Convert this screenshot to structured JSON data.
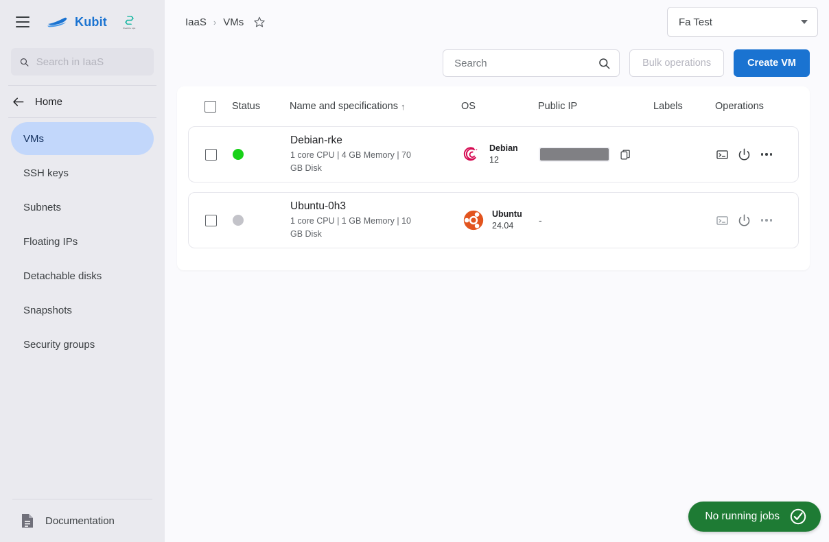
{
  "sidebar": {
    "menu_icon": "hamburger-icon",
    "brand": {
      "name": "Kubit",
      "logo": "kubit-boat-logo"
    },
    "partner": {
      "mark": "S",
      "subtitle": "Flexible ops"
    },
    "search": {
      "value": "",
      "placeholder": "Search in IaaS",
      "icon": "search-icon"
    },
    "home": {
      "label": "Home",
      "icon": "arrow-left-icon"
    },
    "items": [
      {
        "label": "VMs",
        "active": true
      },
      {
        "label": "SSH keys",
        "active": false
      },
      {
        "label": "Subnets",
        "active": false
      },
      {
        "label": "Floating IPs",
        "active": false
      },
      {
        "label": "Detachable disks",
        "active": false
      },
      {
        "label": "Snapshots",
        "active": false
      },
      {
        "label": "Security groups",
        "active": false
      }
    ],
    "documentation": {
      "label": "Documentation",
      "icon": "document-icon"
    }
  },
  "header": {
    "breadcrumbs": [
      {
        "label": "IaaS"
      },
      {
        "label": "VMs"
      }
    ],
    "separator": "›",
    "favorite_icon": "star-outline-icon",
    "project": {
      "selected": "Fa Test",
      "icon": "chevron-down-icon"
    }
  },
  "toolbar": {
    "search": {
      "value": "",
      "placeholder": "Search",
      "icon": "search-icon"
    },
    "bulk_operations_label": "Bulk operations",
    "bulk_operations_disabled": true,
    "create_label": "Create VM"
  },
  "table": {
    "select_all_checked": false,
    "columns": [
      {
        "key": "checkbox",
        "label": ""
      },
      {
        "key": "status",
        "label": "Status"
      },
      {
        "key": "name",
        "label": "Name and specifications",
        "sort": "↑"
      },
      {
        "key": "os",
        "label": "OS"
      },
      {
        "key": "public_ip",
        "label": "Public IP"
      },
      {
        "key": "labels",
        "label": "Labels"
      },
      {
        "key": "operations",
        "label": "Operations"
      }
    ],
    "rows": [
      {
        "checked": false,
        "status": "running",
        "name": "Debian-rke",
        "specs": "1 core CPU | 4 GB Memory | 70 GB Disk",
        "os_name": "Debian",
        "os_version": "12",
        "os_icon": "debian-logo",
        "public_ip": "",
        "public_ip_redacted": true,
        "copy_icon": "copy-icon",
        "labels": "",
        "operations": [
          {
            "icon": "console-icon",
            "enabled": true
          },
          {
            "icon": "power-icon",
            "enabled": true
          },
          {
            "icon": "more-options-icon",
            "enabled": true
          }
        ]
      },
      {
        "checked": false,
        "status": "stopped",
        "name": "Ubuntu-0h3",
        "specs": "1 core CPU | 1 GB Memory | 10 GB Disk",
        "os_name": "Ubuntu",
        "os_version": "24.04",
        "os_icon": "ubuntu-logo",
        "public_ip": "-",
        "public_ip_redacted": false,
        "copy_icon": "",
        "labels": "",
        "operations": [
          {
            "icon": "console-icon",
            "enabled": false
          },
          {
            "icon": "power-icon",
            "enabled": false
          },
          {
            "icon": "more-options-icon",
            "enabled": false
          }
        ]
      }
    ]
  },
  "toast": {
    "label": "No running jobs",
    "icon": "check-circle-icon"
  },
  "annotation": {
    "type": "arrow",
    "color": "#e8201a",
    "points_to": "power-icon-row-1"
  },
  "colors": {
    "accent_blue": "#1a73d1",
    "sidebar_bg": "#eaeaef",
    "active_item": "#c2d7fb",
    "status_running": "#18d118",
    "status_stopped": "#c3c3c9",
    "toast_green": "#1e7b34",
    "debian_red": "#d60a52",
    "ubuntu_orange": "#e2541e"
  }
}
